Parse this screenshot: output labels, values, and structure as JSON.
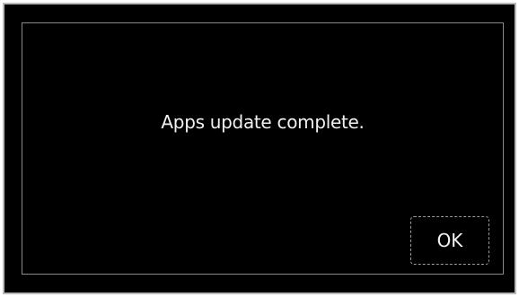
{
  "dialog": {
    "message": "Apps update complete.",
    "ok_label": "OK"
  },
  "colors": {
    "background": "#000000",
    "text": "#f2f2f2",
    "border": "#b9b9b9"
  }
}
